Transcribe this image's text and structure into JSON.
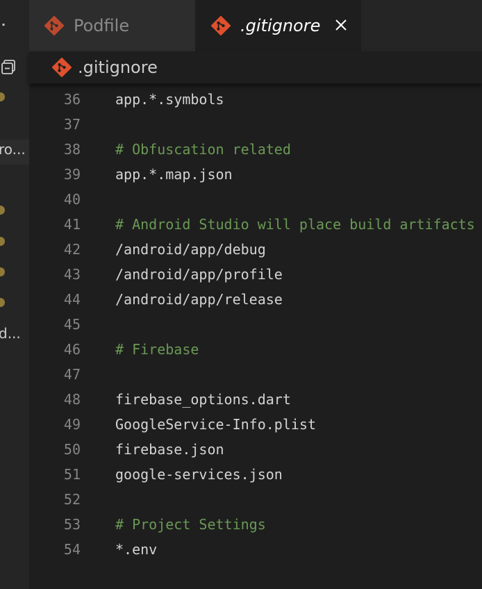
{
  "sidebar": {
    "dots": "·",
    "item_text_1": "ro...",
    "item_text_2": "d..."
  },
  "tabs": [
    {
      "label": "Podfile",
      "icon": "git-icon",
      "active": false
    },
    {
      "label": ".gitignore",
      "icon": "git-icon",
      "active": true
    }
  ],
  "breadcrumb": {
    "label": ".gitignore",
    "icon": "git-icon"
  },
  "colors": {
    "git_icon": "#e0502d",
    "comment": "#6a9955",
    "line_number": "#858585",
    "code": "#d4d4d4"
  },
  "editor": {
    "lines": [
      {
        "num": "36",
        "text": "app.*.symbols",
        "type": "code"
      },
      {
        "num": "37",
        "text": "",
        "type": "code"
      },
      {
        "num": "38",
        "text": "# Obfuscation related",
        "type": "comment"
      },
      {
        "num": "39",
        "text": "app.*.map.json",
        "type": "code"
      },
      {
        "num": "40",
        "text": "",
        "type": "code"
      },
      {
        "num": "41",
        "text": "# Android Studio will place build artifacts",
        "type": "comment"
      },
      {
        "num": "42",
        "text": "/android/app/debug",
        "type": "code"
      },
      {
        "num": "43",
        "text": "/android/app/profile",
        "type": "code"
      },
      {
        "num": "44",
        "text": "/android/app/release",
        "type": "code"
      },
      {
        "num": "45",
        "text": "",
        "type": "code"
      },
      {
        "num": "46",
        "text": "# Firebase",
        "type": "comment"
      },
      {
        "num": "47",
        "text": "",
        "type": "code"
      },
      {
        "num": "48",
        "text": "firebase_options.dart",
        "type": "code"
      },
      {
        "num": "49",
        "text": "GoogleService-Info.plist",
        "type": "code"
      },
      {
        "num": "50",
        "text": "firebase.json",
        "type": "code"
      },
      {
        "num": "51",
        "text": "google-services.json",
        "type": "code"
      },
      {
        "num": "52",
        "text": "",
        "type": "code"
      },
      {
        "num": "53",
        "text": "# Project Settings",
        "type": "comment"
      },
      {
        "num": "54",
        "text": "*.env",
        "type": "code"
      }
    ]
  }
}
